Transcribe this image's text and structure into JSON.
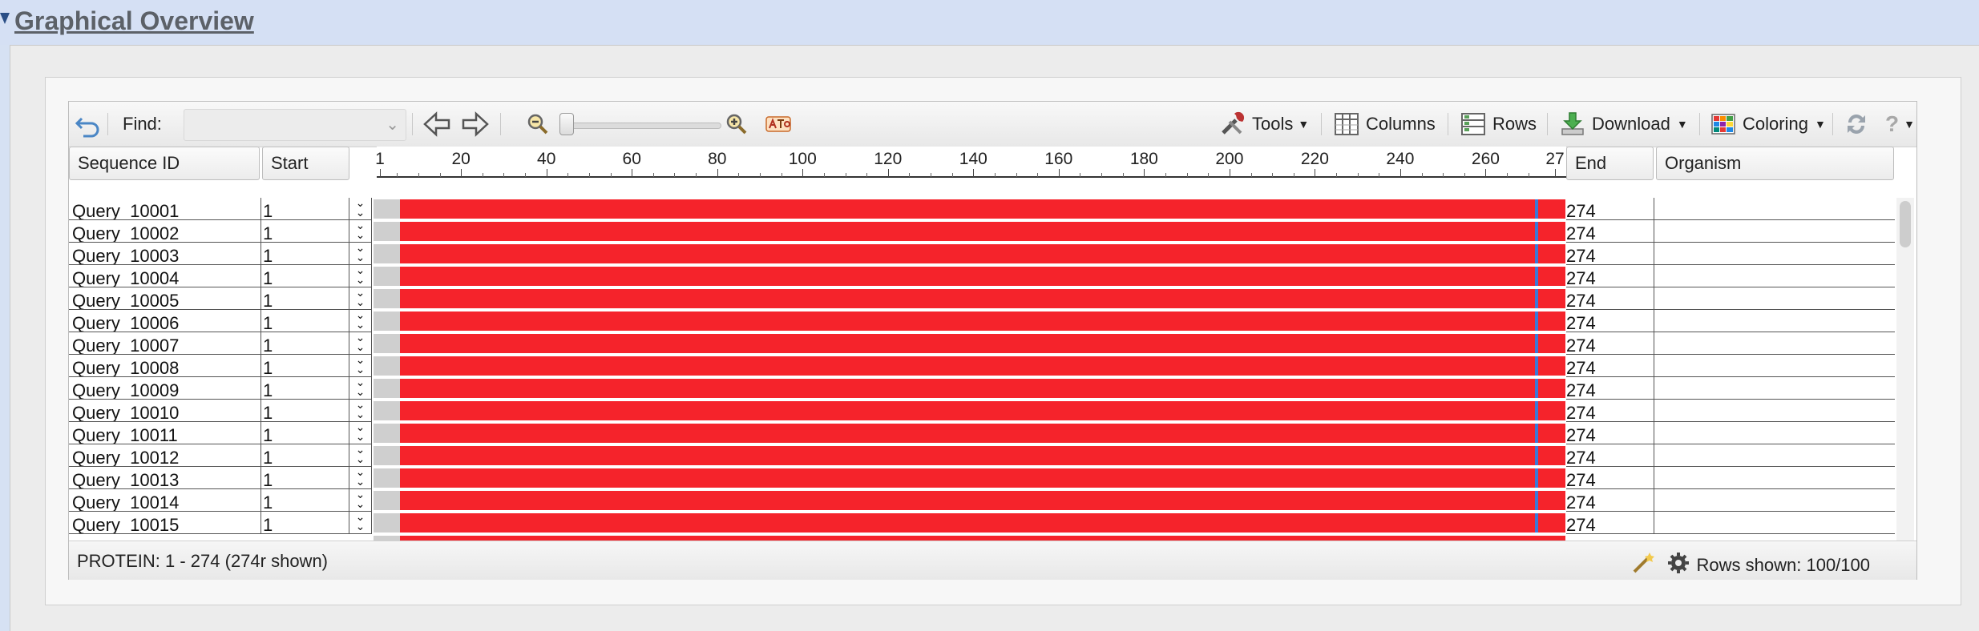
{
  "section": {
    "title": "Graphical Overview"
  },
  "toolbar": {
    "find_label": "Find:",
    "find_value": "",
    "tools_label": "Tools",
    "columns_label": "Columns",
    "rows_label": "Rows",
    "download_label": "Download",
    "coloring_label": "Coloring",
    "zoom_level": 0.0
  },
  "columns": {
    "sequence_id": "Sequence ID",
    "start": "Start",
    "end": "End",
    "organism": "Organism"
  },
  "ruler": {
    "ticks": [
      "1",
      "20",
      "40",
      "60",
      "80",
      "100",
      "120",
      "140",
      "160",
      "180",
      "200",
      "220",
      "240",
      "260",
      "27"
    ]
  },
  "rows": [
    {
      "id": "Query_10001",
      "start": "1",
      "end": "274",
      "organism": ""
    },
    {
      "id": "Query_10002",
      "start": "1",
      "end": "274",
      "organism": ""
    },
    {
      "id": "Query_10003",
      "start": "1",
      "end": "274",
      "organism": ""
    },
    {
      "id": "Query_10004",
      "start": "1",
      "end": "274",
      "organism": ""
    },
    {
      "id": "Query_10005",
      "start": "1",
      "end": "274",
      "organism": ""
    },
    {
      "id": "Query_10006",
      "start": "1",
      "end": "274",
      "organism": ""
    },
    {
      "id": "Query_10007",
      "start": "1",
      "end": "274",
      "organism": ""
    },
    {
      "id": "Query_10008",
      "start": "1",
      "end": "274",
      "organism": ""
    },
    {
      "id": "Query_10009",
      "start": "1",
      "end": "274",
      "organism": ""
    },
    {
      "id": "Query_10010",
      "start": "1",
      "end": "274",
      "organism": ""
    },
    {
      "id": "Query_10011",
      "start": "1",
      "end": "274",
      "organism": ""
    },
    {
      "id": "Query_10012",
      "start": "1",
      "end": "274",
      "organism": ""
    },
    {
      "id": "Query_10013",
      "start": "1",
      "end": "274",
      "organism": ""
    },
    {
      "id": "Query_10014",
      "start": "1",
      "end": "274",
      "organism": ""
    },
    {
      "id": "Query_10015",
      "start": "1",
      "end": "274",
      "organism": ""
    }
  ],
  "footer": {
    "status": "PROTEIN: 1 - 274 (274r shown)",
    "rows_shown": "Rows shown: 100/100"
  },
  "colors": {
    "alignment": "#f5232b",
    "highlight": "#3c77d6",
    "header_bg": "#d5e0f4"
  }
}
